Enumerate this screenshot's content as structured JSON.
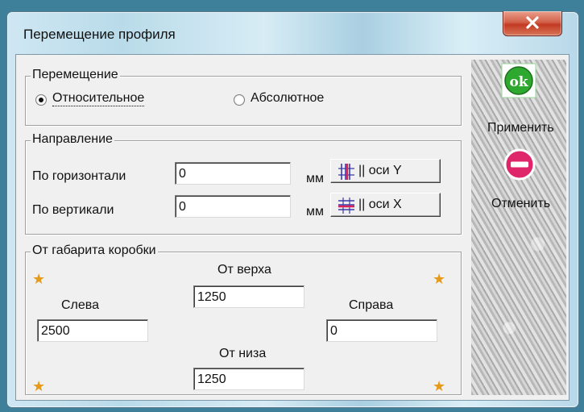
{
  "window": {
    "title": "Перемещение профиля",
    "close_label": "X"
  },
  "movement": {
    "legend": "Перемещение",
    "options": [
      {
        "label": "Относительное",
        "selected": true
      },
      {
        "label": "Абсолютное",
        "selected": false
      }
    ]
  },
  "direction": {
    "legend": "Направление",
    "horizontal": {
      "label": "По горизонтали",
      "value": "0",
      "unit": "мм",
      "button_label": "|| оси Y",
      "button_icon": "grid-vertical-lines-icon"
    },
    "vertical": {
      "label": "По вертикали",
      "value": "0",
      "unit": "мм",
      "button_label": "|| оси X",
      "button_icon": "grid-horizontal-lines-icon"
    }
  },
  "box_dimensions": {
    "legend": "От габарита коробки",
    "top": {
      "label": "От верха",
      "value": "1250"
    },
    "left": {
      "label": "Слева",
      "value": "2500"
    },
    "right": {
      "label": "Справа",
      "value": "0"
    },
    "bottom": {
      "label": "От низа",
      "value": "1250"
    },
    "corner_icon": "star-icon",
    "star_color": "#e69a1a"
  },
  "actions": {
    "apply": {
      "label": "Применить",
      "icon_text": "ok",
      "icon": "ok-icon",
      "color": "#2ea82e"
    },
    "cancel": {
      "label": "Отменить",
      "icon": "no-entry-icon",
      "color": "#e0266a"
    }
  }
}
